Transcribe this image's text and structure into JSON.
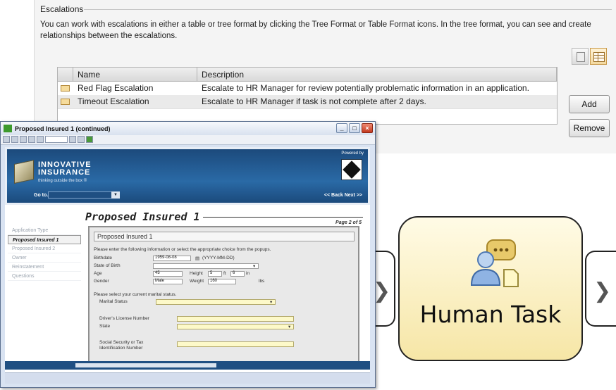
{
  "escalations": {
    "title": "Escalations",
    "description": "You can work with escalations in either a table or tree format by clicking the Tree Format or Table Format icons. In the tree format, you can see and create relationships between the escalations.",
    "columns": [
      "Name",
      "Description"
    ],
    "rows": [
      {
        "name": "Red Flag Escalation",
        "description": "Escalate to HR Manager for review potentially problematic information in an application."
      },
      {
        "name": "Timeout Escalation",
        "description": "Escalate to HR Manager if task is not complete after 2 days."
      }
    ],
    "buttons": {
      "add": "Add",
      "remove": "Remove"
    },
    "view_icons": [
      "tree-format-icon",
      "table-format-icon"
    ]
  },
  "workflow": {
    "node_label": "Human Task",
    "node_icon": "person-with-speech-bubble-icon",
    "arrow_glyph": "❯",
    "node_color": "#f6e6a6"
  },
  "form_window": {
    "title": "Proposed Insured 1 (continued)",
    "brand_line1": "INNOVATIVE",
    "brand_line2": "INSURANCE",
    "brand_tagline": "thinking outside the box ®",
    "powered_by": "Powered by",
    "goto_label": "Go to...",
    "nav_links": "<< Back   Next >>",
    "form_title": "Proposed Insured 1",
    "page_indicator": "Page 2 of 5",
    "side_nav": [
      "Application Type",
      "Proposed Insured 1",
      "Proposed Insured 2",
      "Owner",
      "Reinstatement",
      "Questions"
    ],
    "active_nav_index": 1,
    "panel_title": "Proposed Insured 1",
    "instruction": "Please enter the following information or select the appropriate choice from the popups.",
    "fields": {
      "birthdate_label": "Birthdate",
      "birthdate_value": "1959-08-08",
      "birthdate_hint": "(YYYY-MM-DD)",
      "state_of_birth_label": "State of Birth",
      "age_label": "Age",
      "age_value": "45",
      "height_label": "Height",
      "height_ft": "5",
      "height_unit_ft": "ft",
      "height_in": "6",
      "height_unit_in": "in",
      "gender_label": "Gender",
      "gender_value": "Male",
      "weight_label": "Weight",
      "weight_value": "160",
      "weight_unit": "lbs"
    },
    "marital_prompt": "Please select your current marital status.",
    "marital_label": "Marital Status",
    "license_label": "Driver's License Number",
    "state_label": "State",
    "ssn_label_1": "Social Security or Tax",
    "ssn_label_2": "Identification Number"
  }
}
